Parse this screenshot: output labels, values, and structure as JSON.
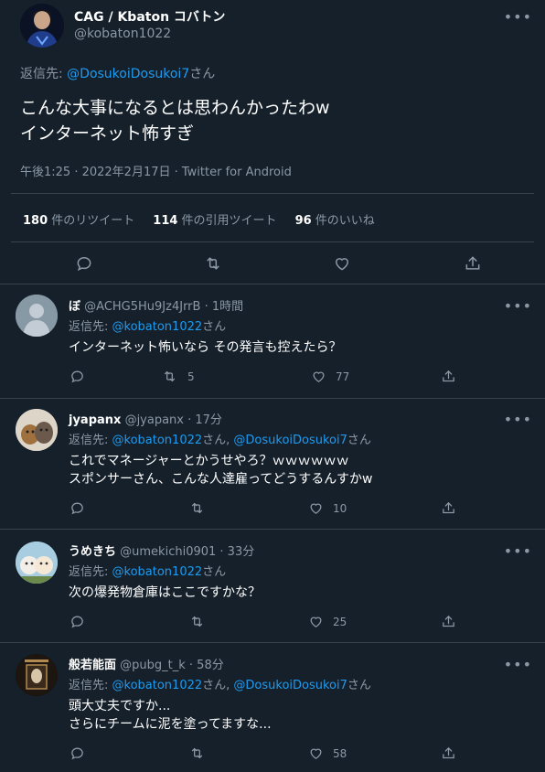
{
  "main_tweet": {
    "display_name": "CAG / Kbaton コバトン",
    "handle": "@kobaton1022",
    "reply_label": "返信先: ",
    "reply_handle": "@DosukoiDosukoi7",
    "reply_suffix": "さん",
    "text_line1": "こんな大事になるとは思わんかったわw",
    "text_line2": "インターネット怖すぎ",
    "meta": "午後1:25 · 2022年2月17日 · Twitter for Android",
    "stats": [
      {
        "num": "180",
        "label": " 件のリツイート"
      },
      {
        "num": "114",
        "label": " 件の引用ツイート"
      },
      {
        "num": "96",
        "label": " 件のいいね"
      }
    ]
  },
  "replies": [
    {
      "name": "ぼ",
      "handle_time": "@ACHG5Hu9Jz4JrrB · 1時間",
      "reply_label": "返信先: ",
      "reply_to": "@kobaton1022",
      "reply_to_2": "",
      "reply_suffix": "さん",
      "line1": "インターネット怖いなら その発言も控えたら？",
      "line2": "",
      "retweets": "5",
      "likes": "77"
    },
    {
      "name": "jyapanx",
      "handle_time": "@jyapanx · 17分",
      "reply_label": "返信先: ",
      "reply_to": "@kobaton1022",
      "reply_mid": "さん, ",
      "reply_to_2": "@DosukoiDosukoi7",
      "reply_suffix": "さん",
      "line1": "これでマネージャーとかうせやろ？ｗｗｗｗｗｗ",
      "line2": "スポンサーさん、こんな人達雇ってどうするんすかw",
      "retweets": "",
      "likes": "10"
    },
    {
      "name": "うめきち",
      "handle_time": "@umekichi0901 · 33分",
      "reply_label": "返信先: ",
      "reply_to": "@kobaton1022",
      "reply_to_2": "",
      "reply_suffix": "さん",
      "line1": "次の爆発物倉庫はここですかな？",
      "line2": "",
      "retweets": "",
      "likes": "25"
    },
    {
      "name": "般若能面",
      "handle_time": "@pubg_t_k · 58分",
      "reply_label": "返信先: ",
      "reply_to": "@kobaton1022",
      "reply_mid": "さん, ",
      "reply_to_2": "@DosukoiDosukoi7",
      "reply_suffix": "さん",
      "line1": "頭大丈夫ですか...",
      "line2": "さらにチームに泥を塗ってますな...",
      "retweets": "",
      "likes": "58"
    }
  ],
  "colors": {
    "background": "#15202b",
    "divider": "#38444d",
    "secondary_text": "#8b98a5",
    "link": "#1d9bf0"
  },
  "icons": [
    "more-icon",
    "reply-icon",
    "retweet-icon",
    "like-icon",
    "share-icon"
  ]
}
